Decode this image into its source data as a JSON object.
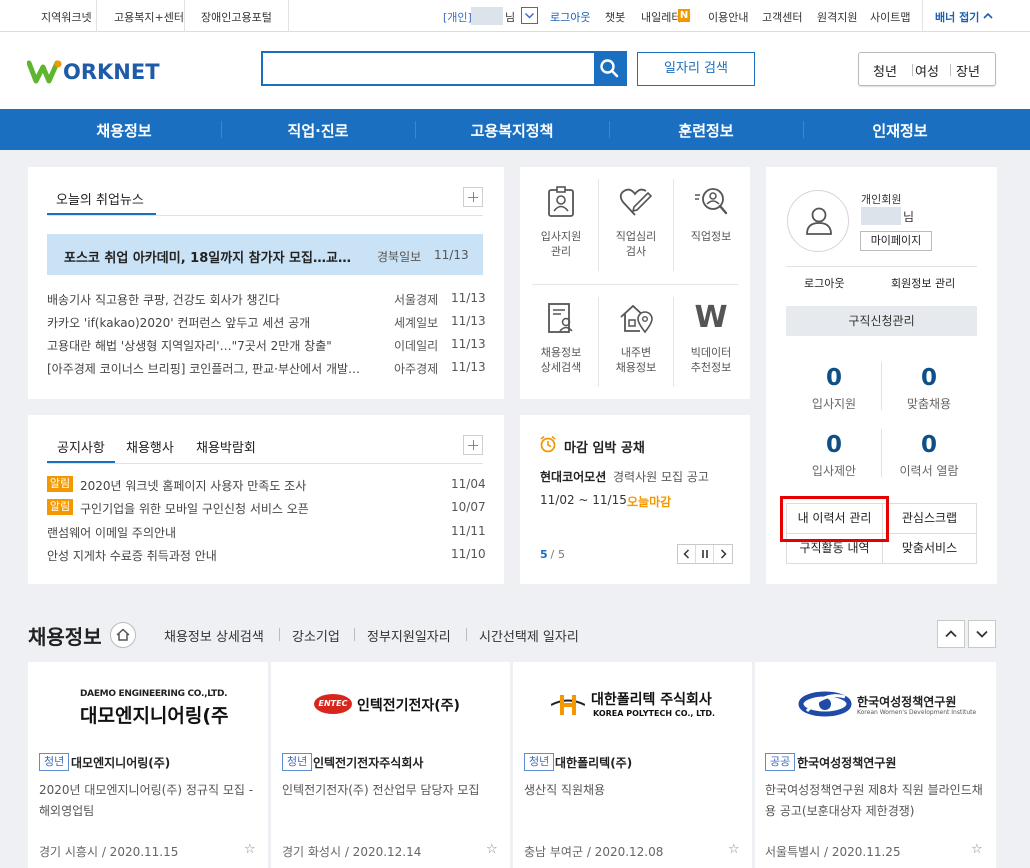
{
  "util": {
    "left_links": [
      "지역워크넷",
      "고용복지+센터",
      "장애인고용포털"
    ],
    "user_prefix": "[개인]",
    "user_suffix": "님",
    "logout": "로그아웃",
    "chatbot": "챗봇",
    "newsletter": "내일레터",
    "new_badge": "N",
    "usage_guide": "이용안내",
    "customer_center": "고객센터",
    "remote_support": "원격지원",
    "sitemap": "사이트맵",
    "banner_toggle": "배너 접기"
  },
  "header": {
    "logo_text": "ORKNET",
    "search_placeholder": "",
    "job_search_button": "일자리 검색",
    "audience": [
      "청년",
      "여성",
      "장년"
    ]
  },
  "gnb": [
    "채용정보",
    "직업·진로",
    "고용복지정책",
    "훈련정보",
    "인재정보"
  ],
  "news": {
    "tab": "오늘의 취업뉴스",
    "featured": {
      "title": "포스코 취업 아카데미, 18일까지 참가자 모집…교…",
      "source": "경북일보",
      "date": "11/13"
    },
    "items": [
      {
        "title": "배송기사 직고용한 쿠팡, 건강도 회사가 챙긴다",
        "source": "서울경제",
        "date": "11/13"
      },
      {
        "title": "카카오 'if(kakao)2020' 컨퍼런스 앞두고 세션 공개",
        "source": "세계일보",
        "date": "11/13"
      },
      {
        "title": "고용대란 해법 '상생형 지역일자리'…\"7곳서 2만개 창출\"",
        "source": "이데일리",
        "date": "11/13"
      },
      {
        "title": "[아주경제 코이너스 브리핑] 코인플러그, 판교·부산에서 개발…",
        "source": "아주경제",
        "date": "11/13"
      }
    ]
  },
  "tiles": [
    {
      "label1": "입사지원",
      "label2": "관리",
      "icon": "id-card-icon"
    },
    {
      "label1": "직업심리",
      "label2": "검사",
      "icon": "heart-pencil-icon"
    },
    {
      "label1": "직업정보",
      "label2": "",
      "icon": "magnify-person-icon"
    },
    {
      "label1": "채용정보",
      "label2": "상세검색",
      "icon": "document-person-icon"
    },
    {
      "label1": "내주변",
      "label2": "채용정보",
      "icon": "house-pin-icon"
    },
    {
      "label1": "빅데이터",
      "label2": "추천정보",
      "icon": "w-logo-icon",
      "glyph": "W"
    }
  ],
  "notice": {
    "tabs": [
      "공지사항",
      "채용행사",
      "채용박람회"
    ],
    "items": [
      {
        "tag": "알림",
        "title": "2020년 워크넷 홈페이지 사용자 만족도 조사",
        "date": "11/04"
      },
      {
        "tag": "알림",
        "title": "구인기업을 위한 모바일 구인신청 서비스 오픈",
        "date": "10/07"
      },
      {
        "tag": "",
        "title": "랜섬웨어 이메일 주의안내",
        "date": "11/11"
      },
      {
        "tag": "",
        "title": "안성 지게차 수료증 취득과정 안내",
        "date": "11/10"
      }
    ]
  },
  "deadline": {
    "title": "마감 임박 공채",
    "company": "현대코어모션",
    "job": "경력사원 모집 공고",
    "period": "11/02 ~ 11/15",
    "tag": "오늘마감",
    "page_current": "5",
    "page_sep": " / ",
    "page_total": "5"
  },
  "profile": {
    "member_type": "개인회원",
    "name_suffix": "님",
    "mypage": "마이페이지",
    "logout": "로그아웃",
    "member_info": "회원정보 관리",
    "job_request": "구직신청관리",
    "stats": [
      {
        "value": "0",
        "label": "입사지원"
      },
      {
        "value": "0",
        "label": "맞춤채용"
      },
      {
        "value": "0",
        "label": "입사제안"
      },
      {
        "value": "0",
        "label": "이력서 열람"
      }
    ],
    "links": [
      "내 이력서 관리",
      "관심스크랩",
      "구직활동 내역",
      "맞춤서비스"
    ],
    "highlight_color": "#e60000"
  },
  "jobs": {
    "section_title": "채용정보",
    "tabs": [
      "채용정보 상세검색",
      "강소기업",
      "정부지원일자리",
      "시간선택제 일자리"
    ],
    "cards": [
      {
        "logo_top": "DAEMO ENGINEERING CO.,LTD.",
        "logo_main": "대모엔지니어링(주)",
        "badge": "청년",
        "company": "대모엔지니어링(주)",
        "title1": "2020년 대모엔지니어링(주) 정규직 모집 -",
        "title2": "해외영업팀",
        "location": "경기 시흥시 / 2020.11.15"
      },
      {
        "logo_top": "ENTEC",
        "logo_main": "인텍전기전자(주)",
        "badge": "청년",
        "company": "인텍전기전자주식회사",
        "title1": "인텍전기전자(주) 전산업무 담당자 모집",
        "title2": "",
        "location": "경기 화성시 / 2020.12.14"
      },
      {
        "logo_top": "대한폴리텍 주식회사",
        "logo_main": "KOREA POLYTECH CO., LTD.",
        "badge": "청년",
        "company": "대한폴리텍(주)",
        "title1": "생산직 직원채용",
        "title2": "",
        "location": "충남 부여군 / 2020.12.08"
      },
      {
        "logo_top": "한국여성정책연구원",
        "logo_main": "Korean Women's Development Institute",
        "badge": "공공",
        "company": "한국여성정책연구원",
        "title1": "한국여성정책연구원 제8차 직원 블라인드채",
        "title2": "용 공고(보훈대상자 제한경쟁)",
        "location": "서울특별시 / 2020.11.25"
      }
    ]
  },
  "colors": {
    "brand_blue": "#1a6fc0",
    "logo_green": "#5fb52e",
    "orange": "#f39800",
    "num_blue": "#0d4f86"
  }
}
